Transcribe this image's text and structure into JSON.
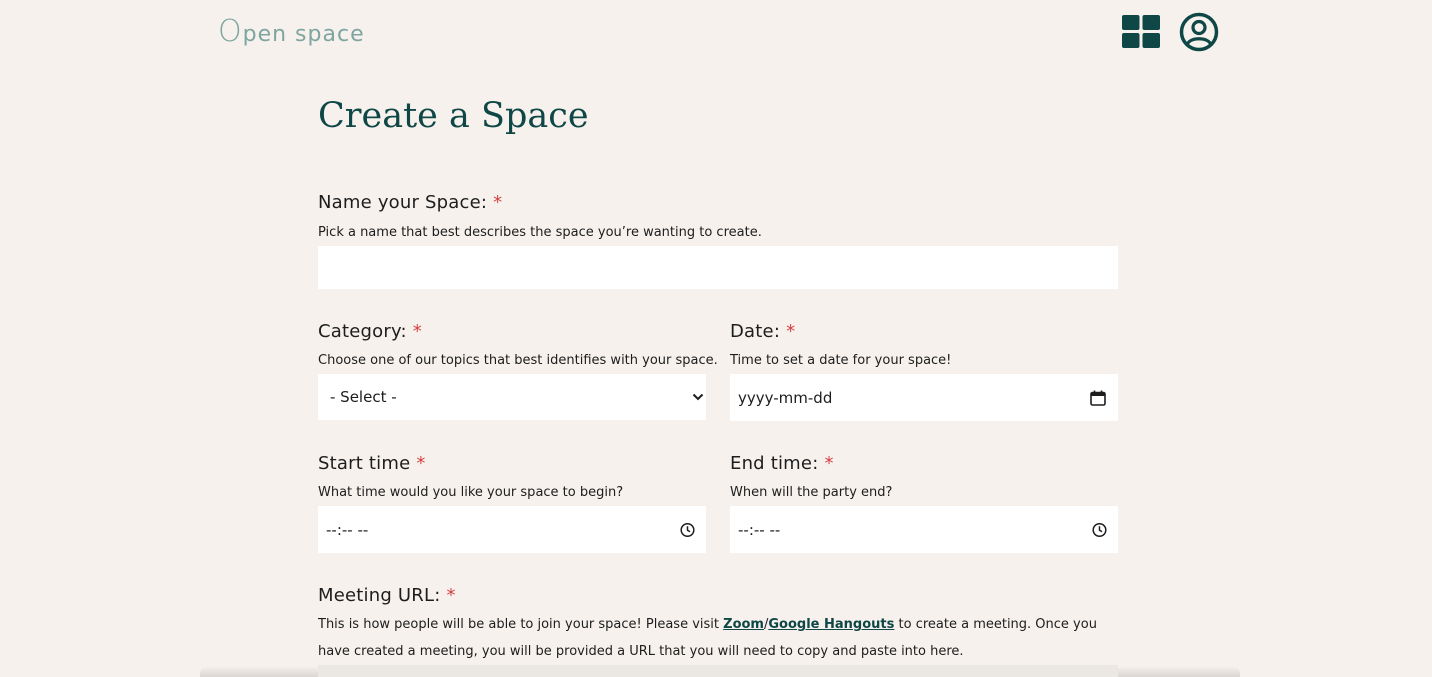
{
  "header": {
    "logo_initial": "O",
    "logo_rest": "pen space",
    "dashboard_icon": "grid-icon",
    "profile_icon": "user-circle-icon"
  },
  "page": {
    "title": "Create a Space"
  },
  "form": {
    "name": {
      "label": "Name your Space:",
      "required_mark": "*",
      "hint": "Pick a name that best describes the space you’re wanting to create.",
      "value": ""
    },
    "category": {
      "label": "Category:",
      "required_mark": "*",
      "hint": "Choose one of our topics that best identifies with your space.",
      "selected": "- Select -"
    },
    "date": {
      "label": "Date:",
      "required_mark": "*",
      "hint": "Time to set a date for your space!",
      "placeholder": "yyyy-mm-dd"
    },
    "start_time": {
      "label": "Start time",
      "required_mark": "*",
      "hint": "What time would you like your space to begin?",
      "placeholder": "--:-- --"
    },
    "end_time": {
      "label": "End time:",
      "required_mark": "*",
      "hint": "When will the party end?",
      "placeholder": "--:-- --"
    },
    "meeting_url": {
      "label": "Meeting URL:",
      "required_mark": "*",
      "hint_before": "This is how people will be able to join your space! Please visit ",
      "link_zoom": "Zoom",
      "separator": "/",
      "link_hangouts": "Google Hangouts",
      "hint_after": " to create a meeting. Once you have created a meeting, you will be provided a URL that you will need to copy and paste into here."
    }
  },
  "colors": {
    "background": "#f6f1ed",
    "brand_dark": "#0f4646",
    "logo": "#7ea5a0",
    "required": "#d43f3f"
  }
}
